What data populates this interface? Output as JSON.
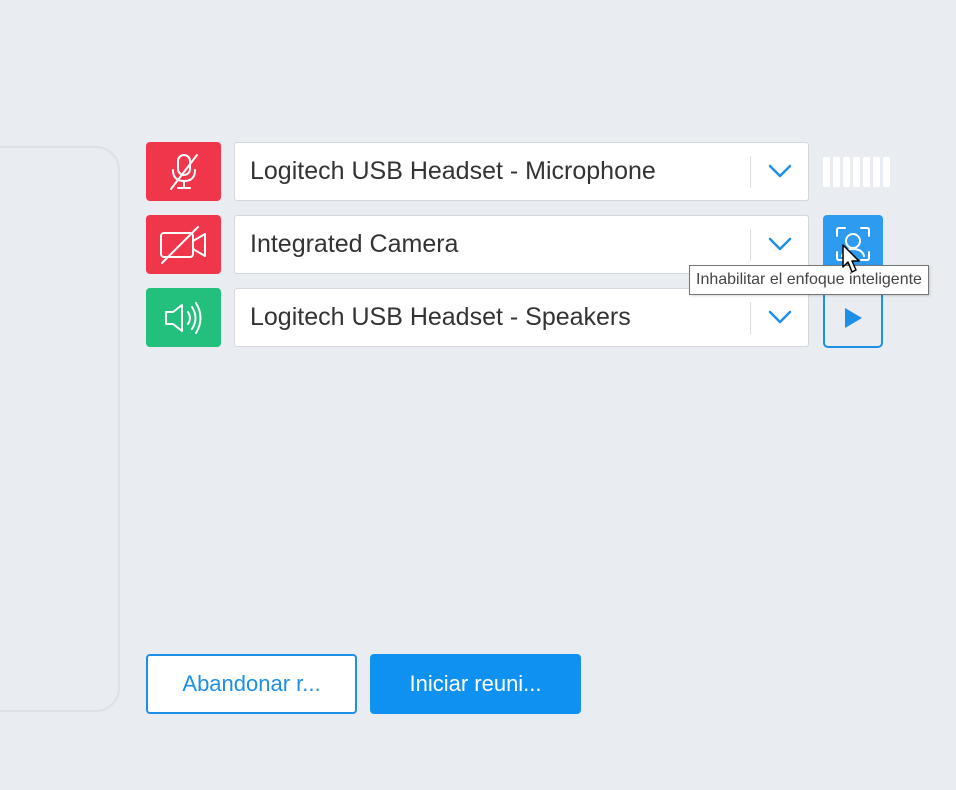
{
  "devices": {
    "microphone": {
      "selected": "Logitech USB Headset - Microphone",
      "toggle_icon": "mic-off-icon",
      "toggle_color": "#f0364a",
      "level_segments": 7
    },
    "camera": {
      "selected": "Integrated Camera",
      "toggle_icon": "video-off-icon",
      "toggle_color": "#f0364a",
      "focus_icon": "smart-focus-icon"
    },
    "speakers": {
      "selected": "Logitech USB Headset - Speakers",
      "toggle_icon": "speaker-icon",
      "toggle_color": "#23bf7c",
      "test_icon": "play-icon"
    }
  },
  "tooltip": {
    "text": "Inhabilitar el enfoque inteligente"
  },
  "actions": {
    "leave_label": "Abandonar r...",
    "start_label": "Iniciar reuni..."
  },
  "colors": {
    "accent": "#0f91f2",
    "danger": "#f0364a",
    "success": "#23bf7c",
    "background": "#e9ecf1"
  }
}
